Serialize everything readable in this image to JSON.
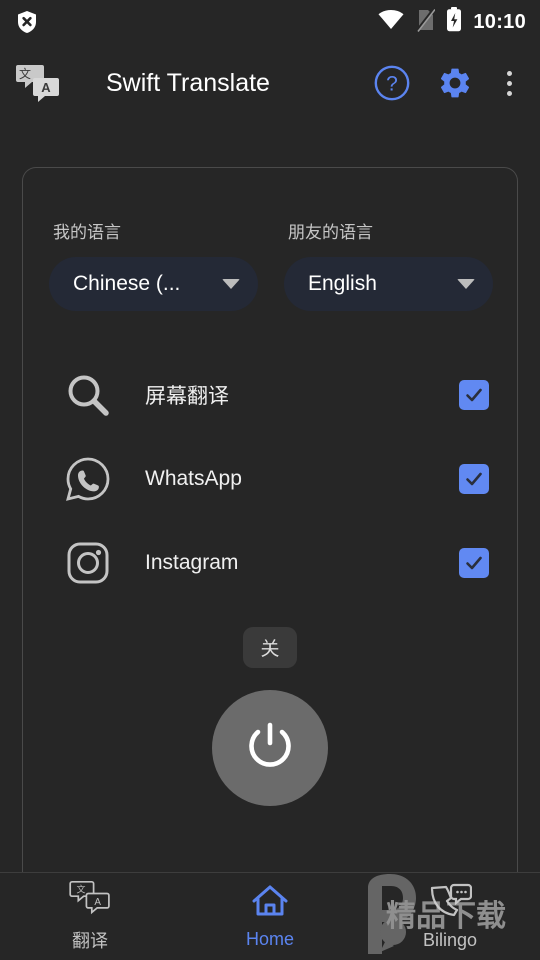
{
  "status_bar": {
    "left_icon": "shield-x-icon",
    "icons": [
      "wifi-icon",
      "no-sim-icon",
      "battery-charging-icon"
    ],
    "time": "10:10"
  },
  "app_bar": {
    "logo_icon": "translate-bubbles-icon",
    "title": "Swift Translate",
    "help_label": "?",
    "actions": [
      {
        "name": "help-icon",
        "label": "?"
      },
      {
        "name": "settings-gear-icon",
        "label": ""
      },
      {
        "name": "overflow-menu-icon",
        "label": ""
      }
    ]
  },
  "language_selectors": [
    {
      "label": "我的语言",
      "value": "Chinese (...",
      "name": "my-language"
    },
    {
      "label": "朋友的语言",
      "value": "English",
      "name": "friend-language"
    }
  ],
  "app_list": [
    {
      "icon": "magnifier-icon",
      "name": "屏幕翻译",
      "checked": true
    },
    {
      "icon": "whatsapp-icon",
      "name": "WhatsApp",
      "checked": true
    },
    {
      "icon": "instagram-icon",
      "name": "Instagram",
      "checked": true
    }
  ],
  "power": {
    "state_label": "关",
    "button_icon": "power-icon"
  },
  "bottom_nav": [
    {
      "icon": "translate-bubbles-icon",
      "label": "翻译",
      "active": false
    },
    {
      "icon": "home-icon",
      "label": "Home",
      "active": true
    },
    {
      "icon": "phone-chat-icon",
      "label": "Bilingo",
      "active": false
    }
  ],
  "watermark": {
    "text": "精品下载",
    "logo": "p-logo"
  },
  "colors": {
    "accent": "#6189f2",
    "background": "#262626",
    "pill": "#242936",
    "checkbox": "#6189f2",
    "power_button": "#6b6b6b"
  }
}
